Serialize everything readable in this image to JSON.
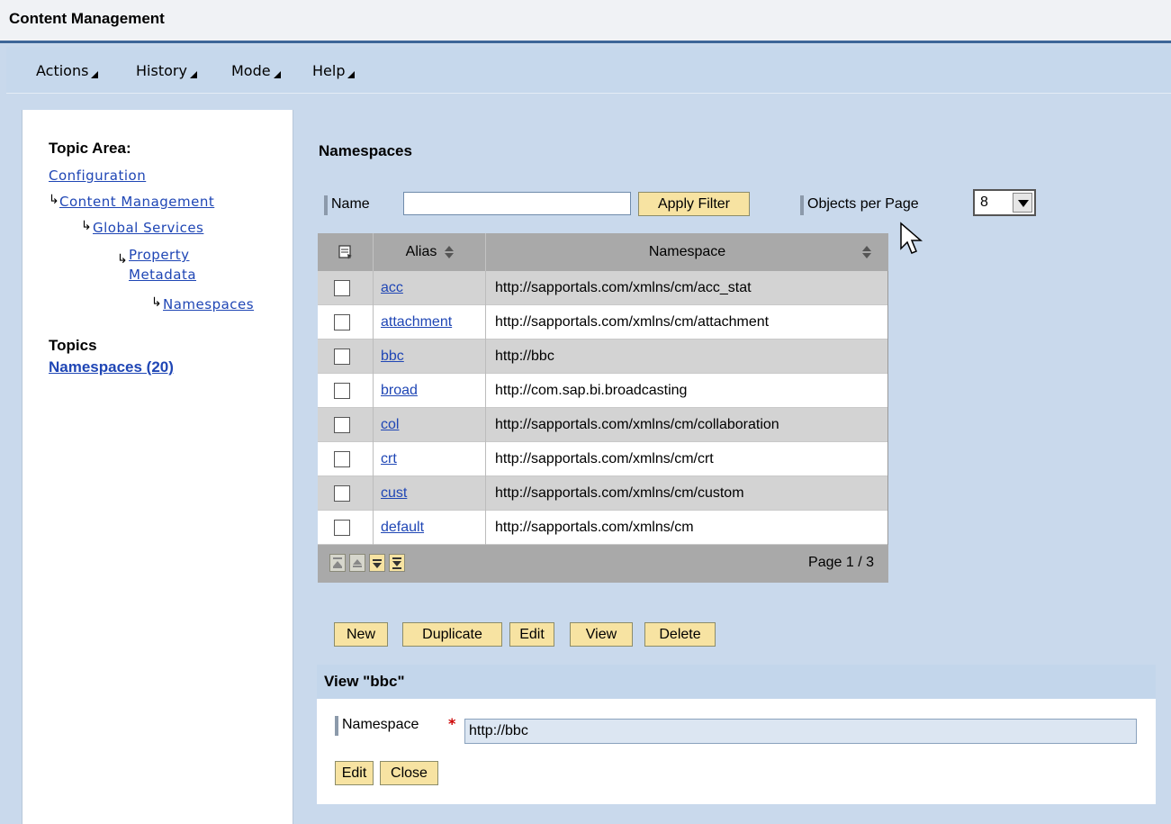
{
  "window": {
    "title": "Content Management"
  },
  "menu": [
    {
      "label": "Actions"
    },
    {
      "label": "History"
    },
    {
      "label": "Mode"
    },
    {
      "label": "Help"
    }
  ],
  "left_panel": {
    "topic_area_heading": "Topic Area:",
    "breadcrumbs": [
      {
        "label": "Configuration"
      },
      {
        "label": "Content Management"
      },
      {
        "label": "Global Services"
      },
      {
        "label_line1": "Property",
        "label_line2": "Metadata"
      },
      {
        "label": "Namespaces"
      }
    ],
    "topics_heading": "Topics",
    "topics_link": "Namespaces (20)"
  },
  "main": {
    "heading": "Namespaces",
    "filter": {
      "name_label": "Name",
      "name_value": "",
      "apply_button": "Apply Filter",
      "per_page_label": "Objects per Page",
      "per_page_value": "8"
    },
    "table": {
      "columns": {
        "select_icon": "select-all-icon",
        "alias": "Alias",
        "namespace": "Namespace"
      },
      "rows": [
        {
          "alias": "acc",
          "namespace": "http://sapportals.com/xmlns/cm/acc_stat"
        },
        {
          "alias": "attachment",
          "namespace": "http://sapportals.com/xmlns/cm/attachment"
        },
        {
          "alias": "bbc",
          "namespace": "http://bbc"
        },
        {
          "alias": "broad",
          "namespace": "http://com.sap.bi.broadcasting"
        },
        {
          "alias": "col",
          "namespace": "http://sapportals.com/xmlns/cm/collaboration"
        },
        {
          "alias": "crt",
          "namespace": "http://sapportals.com/xmlns/cm/crt"
        },
        {
          "alias": "cust",
          "namespace": "http://sapportals.com/xmlns/cm/custom"
        },
        {
          "alias": "default",
          "namespace": "http://sapportals.com/xmlns/cm"
        }
      ],
      "page_info": "Page 1 / 3"
    },
    "actions": {
      "new": "New",
      "duplicate": "Duplicate",
      "edit": "Edit",
      "view": "View",
      "delete": "Delete"
    },
    "detail": {
      "title": "View \"bbc\"",
      "namespace_label": "Namespace",
      "required_mark": "*",
      "namespace_value": "http://bbc",
      "edit_button": "Edit",
      "close_button": "Close"
    }
  }
}
